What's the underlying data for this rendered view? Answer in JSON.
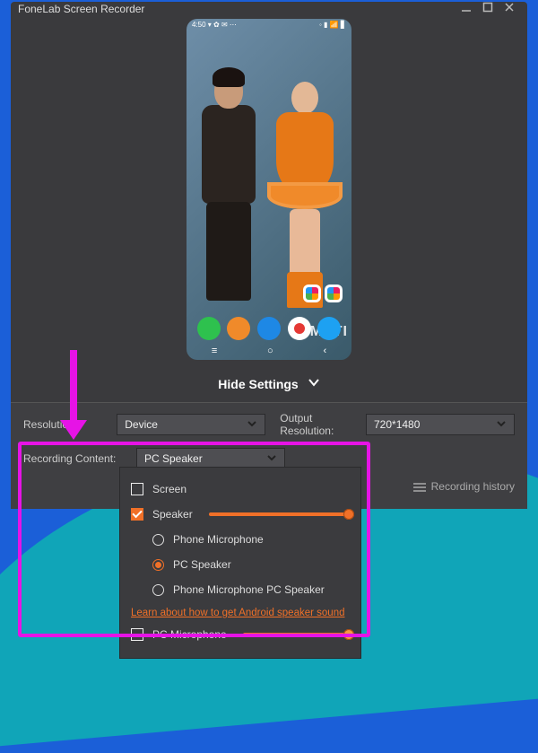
{
  "window": {
    "title": "FoneLab Screen Recorder"
  },
  "phone": {
    "status_left": "4:50 ▾ ✿ ✉ ⋯",
    "status_right": "◦ ▮ 📶 ▋",
    "watermark": "METI",
    "nav": {
      "recent": "≡",
      "home": "○",
      "back": "‹"
    }
  },
  "hide_settings_label": "Hide Settings",
  "settings": {
    "resolution_label": "Resolution:",
    "resolution_value": "Device",
    "output_resolution_label": "Output Resolution:",
    "output_resolution_value": "720*1480",
    "recording_content_label": "Recording Content:",
    "recording_content_value": "PC Speaker",
    "recording_history": "Recording history"
  },
  "dropdown": {
    "screen": "Screen",
    "speaker": "Speaker",
    "phone_mic": "Phone Microphone",
    "pc_speaker": "PC Speaker",
    "phone_mic_pc_speaker": "Phone Microphone  PC Speaker",
    "learn_link": "Learn about how to get Android speaker sound",
    "pc_microphone": "PC Microphone"
  }
}
